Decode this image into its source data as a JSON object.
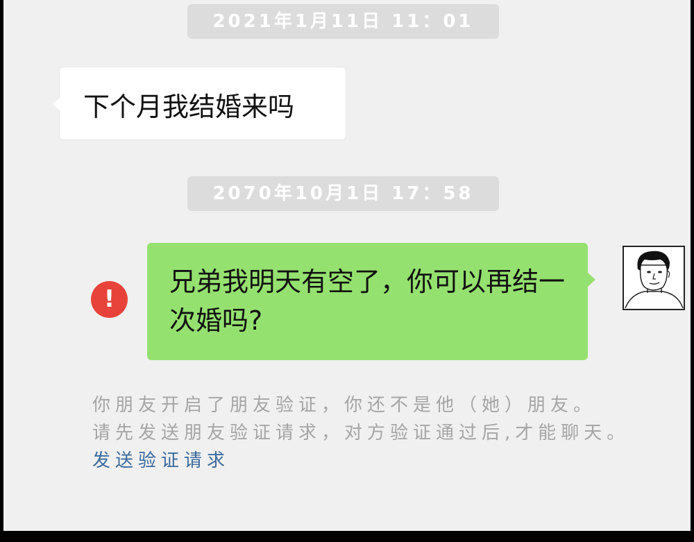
{
  "conversation": {
    "timestamp_1": "2021年1月11日  11：01",
    "incoming_message": "下个月我结婚来吗",
    "timestamp_2": "2070年10月1日  17：58",
    "outgoing_message": "兄弟我明天有空了，你可以再结一次婚吗?",
    "failed_icon_glyph": "!"
  },
  "notice": {
    "line1": "你朋友开启了朋友验证，你还不是他（她）朋友。",
    "line2": "请先发送朋友验证请求，对方验证通过后,才能聊天。",
    "link": "发送验证请求"
  },
  "colors": {
    "background": "#f0f0f0",
    "outgoing_bubble": "#95e170",
    "incoming_bubble": "#ffffff",
    "error_icon": "#e8433a",
    "link": "#3b6a9c"
  },
  "icons": {
    "failed": "exclamation-circle-icon",
    "avatar": "meme-face-avatar"
  }
}
